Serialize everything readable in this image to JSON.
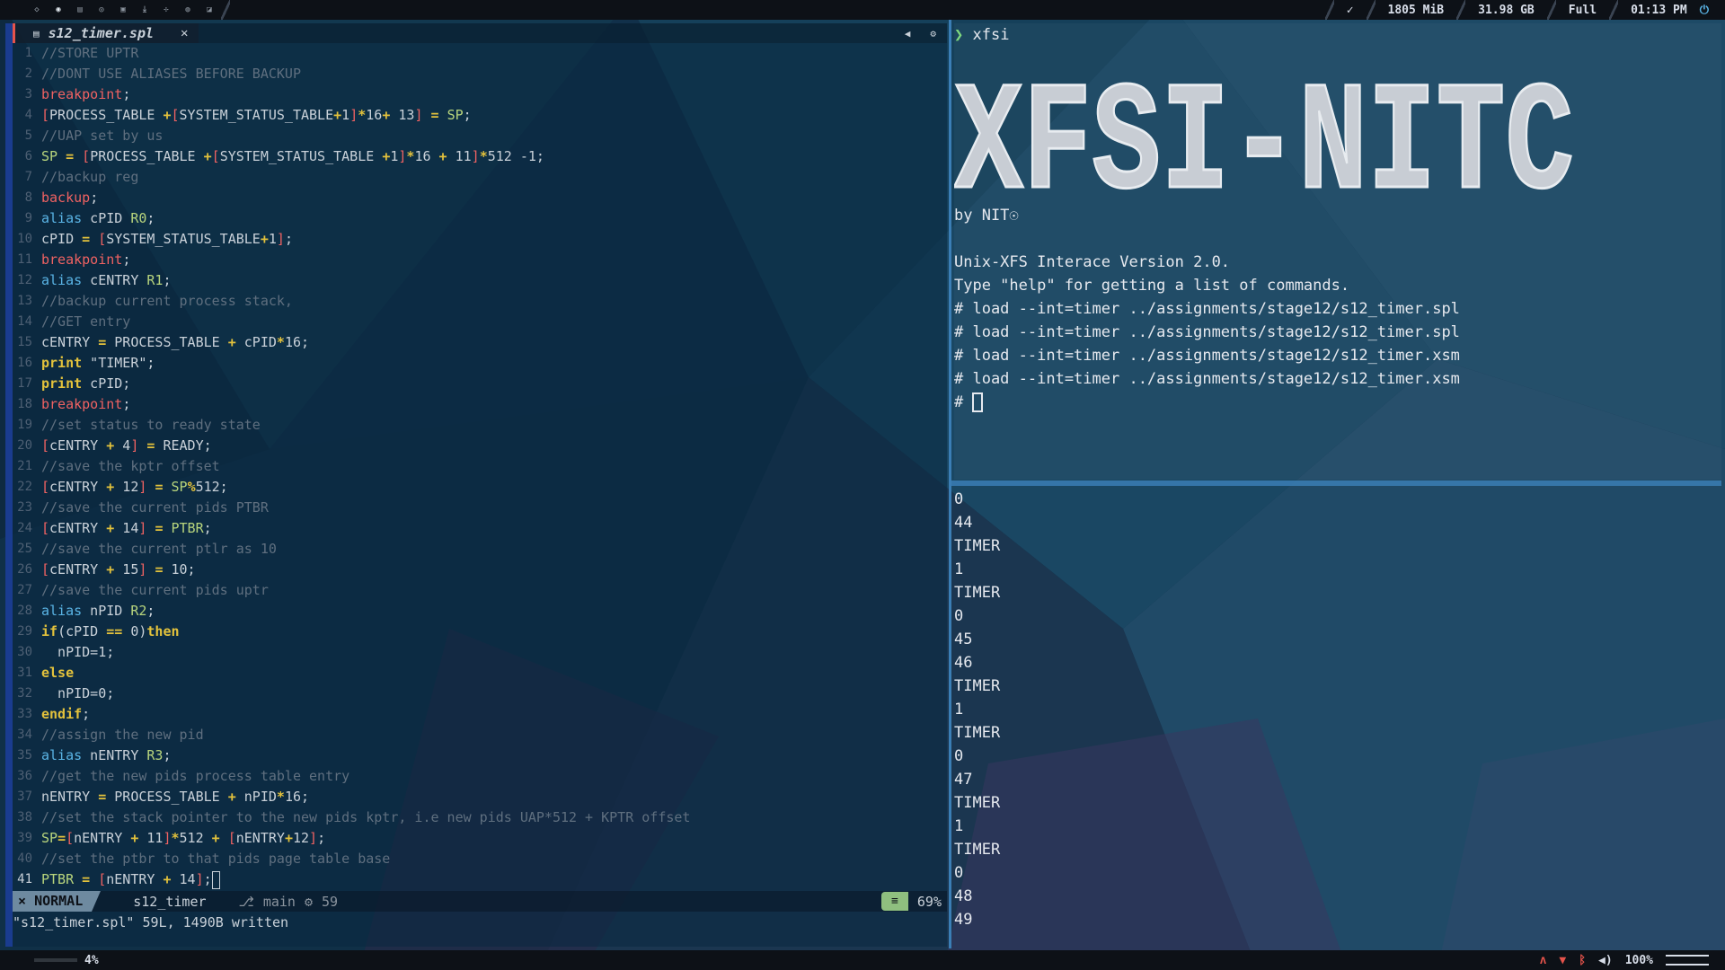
{
  "topbar": {
    "workspace_icons": [
      "code-icon",
      "terminal-icon",
      "browser-icon",
      "chat-icon",
      "files-icon",
      "download-icon",
      "settings-icon",
      "music-icon",
      "mail-icon"
    ],
    "active_workspace": 1,
    "check_symbol": "✓",
    "memory": "1805 MiB",
    "disk": "31.98 GB",
    "battery": "Full",
    "clock": "01:13 PM"
  },
  "editor": {
    "tab_title": "s12_timer.spl",
    "tab_close": "✕",
    "lines": [
      {
        "n": "1",
        "parts": [
          [
            "cm",
            "//STORE UPTR"
          ]
        ]
      },
      {
        "n": "2",
        "parts": [
          [
            "cm",
            "//DONT USE ALIASES BEFORE BACKUP"
          ]
        ]
      },
      {
        "n": "3",
        "parts": [
          [
            "rd",
            "breakpoint"
          ],
          [
            "pl",
            ";"
          ]
        ]
      },
      {
        "n": "4",
        "parts": [
          [
            "rd",
            "["
          ],
          [
            "pl",
            "PROCESS_TABLE "
          ],
          [
            "kw",
            "+"
          ],
          [
            "rd",
            "["
          ],
          [
            "pl",
            "SYSTEM_STATUS_TABLE"
          ],
          [
            "kw",
            "+"
          ],
          [
            "pl",
            "1"
          ],
          [
            "rd",
            "]"
          ],
          [
            "kw",
            "*"
          ],
          [
            "pl",
            "16"
          ],
          [
            "kw",
            "+"
          ],
          [
            "pl",
            " 13"
          ],
          [
            "rd",
            "]"
          ],
          [
            "pl",
            " "
          ],
          [
            "kw",
            "="
          ],
          [
            "pl",
            " "
          ],
          [
            "gr",
            "SP"
          ],
          [
            "pl",
            ";"
          ]
        ]
      },
      {
        "n": "5",
        "parts": [
          [
            "cm",
            "//UAP set by us"
          ]
        ]
      },
      {
        "n": "6",
        "parts": [
          [
            "gr",
            "SP"
          ],
          [
            "pl",
            " "
          ],
          [
            "kw",
            "="
          ],
          [
            "pl",
            " "
          ],
          [
            "rd",
            "["
          ],
          [
            "pl",
            "PROCESS_TABLE "
          ],
          [
            "kw",
            "+"
          ],
          [
            "rd",
            "["
          ],
          [
            "pl",
            "SYSTEM_STATUS_TABLE "
          ],
          [
            "kw",
            "+"
          ],
          [
            "pl",
            "1"
          ],
          [
            "rd",
            "]"
          ],
          [
            "kw",
            "*"
          ],
          [
            "pl",
            "16 "
          ],
          [
            "kw",
            "+"
          ],
          [
            "pl",
            " 11"
          ],
          [
            "rd",
            "]"
          ],
          [
            "kw",
            "*"
          ],
          [
            "pl",
            "512 -1;"
          ]
        ]
      },
      {
        "n": "7",
        "parts": [
          [
            "cm",
            "//backup reg"
          ]
        ]
      },
      {
        "n": "8",
        "parts": [
          [
            "rd",
            "backup"
          ],
          [
            "pl",
            ";"
          ]
        ]
      },
      {
        "n": "9",
        "parts": [
          [
            "kw2",
            "alias"
          ],
          [
            "pl",
            " cPID "
          ],
          [
            "gr",
            "R0"
          ],
          [
            "pl",
            ";"
          ]
        ]
      },
      {
        "n": "10",
        "parts": [
          [
            "pl",
            "cPID "
          ],
          [
            "kw",
            "="
          ],
          [
            "pl",
            " "
          ],
          [
            "rd",
            "["
          ],
          [
            "pl",
            "SYSTEM_STATUS_TABLE"
          ],
          [
            "kw",
            "+"
          ],
          [
            "pl",
            "1"
          ],
          [
            "rd",
            "]"
          ],
          [
            "pl",
            ";"
          ]
        ]
      },
      {
        "n": "11",
        "parts": [
          [
            "rd",
            "breakpoint"
          ],
          [
            "pl",
            ";"
          ]
        ]
      },
      {
        "n": "12",
        "parts": [
          [
            "kw2",
            "alias"
          ],
          [
            "pl",
            " cENTRY "
          ],
          [
            "gr",
            "R1"
          ],
          [
            "pl",
            ";"
          ]
        ]
      },
      {
        "n": "13",
        "parts": [
          [
            "cm",
            "//backup current process stack,"
          ]
        ]
      },
      {
        "n": "14",
        "parts": [
          [
            "cm",
            "//GET entry"
          ]
        ]
      },
      {
        "n": "15",
        "parts": [
          [
            "pl",
            "cENTRY "
          ],
          [
            "kw",
            "="
          ],
          [
            "pl",
            " PROCESS_TABLE "
          ],
          [
            "kw",
            "+"
          ],
          [
            "pl",
            " cPID"
          ],
          [
            "kw",
            "*"
          ],
          [
            "pl",
            "16;"
          ]
        ]
      },
      {
        "n": "16",
        "parts": [
          [
            "kw",
            "print"
          ],
          [
            "pl",
            " \"TIMER\";"
          ]
        ]
      },
      {
        "n": "17",
        "parts": [
          [
            "kw",
            "print"
          ],
          [
            "pl",
            " cPID;"
          ]
        ]
      },
      {
        "n": "18",
        "parts": [
          [
            "rd",
            "breakpoint"
          ],
          [
            "pl",
            ";"
          ]
        ]
      },
      {
        "n": "19",
        "parts": [
          [
            "cm",
            "//set status to ready state"
          ]
        ]
      },
      {
        "n": "20",
        "parts": [
          [
            "rd",
            "["
          ],
          [
            "pl",
            "cENTRY "
          ],
          [
            "kw",
            "+"
          ],
          [
            "pl",
            " 4"
          ],
          [
            "rd",
            "]"
          ],
          [
            "pl",
            " "
          ],
          [
            "kw",
            "="
          ],
          [
            "pl",
            " READY;"
          ]
        ]
      },
      {
        "n": "21",
        "parts": [
          [
            "cm",
            "//save the kptr offset"
          ]
        ]
      },
      {
        "n": "22",
        "parts": [
          [
            "rd",
            "["
          ],
          [
            "pl",
            "cENTRY "
          ],
          [
            "kw",
            "+"
          ],
          [
            "pl",
            " 12"
          ],
          [
            "rd",
            "]"
          ],
          [
            "pl",
            " "
          ],
          [
            "kw",
            "="
          ],
          [
            "pl",
            " "
          ],
          [
            "gr",
            "SP"
          ],
          [
            "kw",
            "%"
          ],
          [
            "pl",
            "512;"
          ]
        ]
      },
      {
        "n": "23",
        "parts": [
          [
            "cm",
            "//save the current pids PTBR"
          ]
        ]
      },
      {
        "n": "24",
        "parts": [
          [
            "rd",
            "["
          ],
          [
            "pl",
            "cENTRY "
          ],
          [
            "kw",
            "+"
          ],
          [
            "pl",
            " 14"
          ],
          [
            "rd",
            "]"
          ],
          [
            "pl",
            " "
          ],
          [
            "kw",
            "="
          ],
          [
            "pl",
            " "
          ],
          [
            "gr",
            "PTBR"
          ],
          [
            "pl",
            ";"
          ]
        ]
      },
      {
        "n": "25",
        "parts": [
          [
            "cm",
            "//save the current ptlr as 10"
          ]
        ]
      },
      {
        "n": "26",
        "parts": [
          [
            "rd",
            "["
          ],
          [
            "pl",
            "cENTRY "
          ],
          [
            "kw",
            "+"
          ],
          [
            "pl",
            " 15"
          ],
          [
            "rd",
            "]"
          ],
          [
            "pl",
            " "
          ],
          [
            "kw",
            "="
          ],
          [
            "pl",
            " 10;"
          ]
        ]
      },
      {
        "n": "27",
        "parts": [
          [
            "cm",
            "//save the current pids uptr"
          ]
        ]
      },
      {
        "n": "28",
        "parts": [
          [
            "kw2",
            "alias"
          ],
          [
            "pl",
            " nPID "
          ],
          [
            "gr",
            "R2"
          ],
          [
            "pl",
            ";"
          ]
        ]
      },
      {
        "n": "29",
        "parts": [
          [
            "kw",
            "if"
          ],
          [
            "pl",
            "(cPID "
          ],
          [
            "kw",
            "=="
          ],
          [
            "pl",
            " 0)"
          ],
          [
            "kw",
            "then"
          ]
        ]
      },
      {
        "n": "30",
        "parts": [
          [
            "pl",
            "  nPID=1;"
          ]
        ]
      },
      {
        "n": "31",
        "parts": [
          [
            "kw",
            "else"
          ]
        ]
      },
      {
        "n": "32",
        "parts": [
          [
            "pl",
            "  nPID=0;"
          ]
        ]
      },
      {
        "n": "33",
        "parts": [
          [
            "kw",
            "endif"
          ],
          [
            "pl",
            ";"
          ]
        ]
      },
      {
        "n": "34",
        "parts": [
          [
            "cm",
            "//assign the new pid"
          ]
        ]
      },
      {
        "n": "35",
        "parts": [
          [
            "kw2",
            "alias"
          ],
          [
            "pl",
            " nENTRY "
          ],
          [
            "gr",
            "R3"
          ],
          [
            "pl",
            ";"
          ]
        ]
      },
      {
        "n": "36",
        "parts": [
          [
            "cm",
            "//get the new pids process table entry"
          ]
        ]
      },
      {
        "n": "37",
        "parts": [
          [
            "pl",
            "nENTRY "
          ],
          [
            "kw",
            "="
          ],
          [
            "pl",
            " PROCESS_TABLE "
          ],
          [
            "kw",
            "+"
          ],
          [
            "pl",
            " nPID"
          ],
          [
            "kw",
            "*"
          ],
          [
            "pl",
            "16;"
          ]
        ]
      },
      {
        "n": "38",
        "parts": [
          [
            "cm",
            "//set the stack pointer to the new pids kptr, i.e new pids UAP*512 + KPTR offset"
          ]
        ]
      },
      {
        "n": "39",
        "parts": [
          [
            "gr",
            "SP"
          ],
          [
            "kw",
            "="
          ],
          [
            "rd",
            "["
          ],
          [
            "pl",
            "nENTRY "
          ],
          [
            "kw",
            "+"
          ],
          [
            "pl",
            " 11"
          ],
          [
            "rd",
            "]"
          ],
          [
            "kw",
            "*"
          ],
          [
            "pl",
            "512 "
          ],
          [
            "kw",
            "+"
          ],
          [
            "pl",
            " "
          ],
          [
            "rd",
            "["
          ],
          [
            "pl",
            "nENTRY"
          ],
          [
            "kw",
            "+"
          ],
          [
            "pl",
            "12"
          ],
          [
            "rd",
            "]"
          ],
          [
            "pl",
            ";"
          ]
        ]
      },
      {
        "n": "40",
        "parts": [
          [
            "cm",
            "//set the ptbr to that pids page table base"
          ]
        ]
      },
      {
        "n": "41",
        "parts": [
          [
            "gr",
            "PTBR"
          ],
          [
            "pl",
            " "
          ],
          [
            "kw",
            "="
          ],
          [
            "pl",
            " "
          ],
          [
            "rd",
            "["
          ],
          [
            "pl",
            "nENTRY "
          ],
          [
            "kw",
            "+"
          ],
          [
            "pl",
            " 14"
          ],
          [
            "rd",
            "]"
          ],
          [
            "pl",
            ";"
          ]
        ],
        "cursor": true
      }
    ],
    "status": {
      "mode": "NORMAL",
      "file": "s12_timer",
      "branch": "main",
      "changes": "59",
      "filetype_icon": "≡",
      "percent": "69%"
    },
    "cmdline": "\"s12_timer.spl\" 59L, 1490B written"
  },
  "terminal_top": {
    "prompt_arrow": "❯",
    "command": "xfsi",
    "banner": "XFSI-NITC",
    "byline": "by NIT☉",
    "lines": [
      "Unix-XFS Interace Version 2.0.",
      "Type \"help\" for getting a list of commands.",
      "# load --int=timer ../assignments/stage12/s12_timer.spl",
      "# load --int=timer ../assignments/stage12/s12_timer.spl",
      "# load --int=timer ../assignments/stage12/s12_timer.xsm",
      "# load --int=timer ../assignments/stage12/s12_timer.xsm"
    ],
    "prompt_hash": "# "
  },
  "terminal_bottom": {
    "lines": [
      "0",
      "44",
      "TIMER",
      "1",
      "TIMER",
      "0",
      "45",
      "46",
      "TIMER",
      "1",
      "TIMER",
      "0",
      "47",
      "TIMER",
      "1",
      "TIMER",
      "0",
      "48",
      "49"
    ]
  },
  "bottombar": {
    "cpu": "4%",
    "volume": "100%",
    "volume_icon": "speaker-icon"
  },
  "colors": {
    "accent": "#3b7eb5",
    "keyword": "#e3c23c",
    "string_red": "#f06262",
    "register_green": "#b8d57d",
    "comment": "#5f6f7f"
  }
}
